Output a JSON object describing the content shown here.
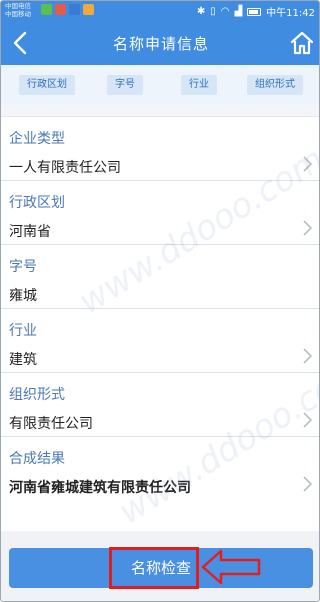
{
  "status_bar": {
    "carrier_line1": "中国电信",
    "carrier_line2": "中国移动",
    "time": "中午11:42",
    "icon_colors": [
      "#5bbf4e",
      "#e65a4a",
      "#3a7ad6",
      "#f2a93b"
    ]
  },
  "nav": {
    "title": "名称申请信息",
    "back_icon": "chevron-left-icon",
    "home_icon": "home-icon"
  },
  "chips": [
    "行政区划",
    "字号",
    "行业",
    "组织形式"
  ],
  "form": {
    "rows": [
      {
        "label": "企业类型",
        "value": "一人有限责任公司",
        "has_chevron": true
      },
      {
        "label": "行政区划",
        "value": "河南省",
        "has_chevron": true
      },
      {
        "label": "字号",
        "value": "雍城",
        "has_chevron": false
      },
      {
        "label": "行业",
        "value": "建筑",
        "has_chevron": true
      },
      {
        "label": "组织形式",
        "value": "有限责任公司",
        "has_chevron": true
      },
      {
        "label": "合成结果",
        "value": "河南省雍城建筑有限责任公司",
        "has_chevron": true
      }
    ]
  },
  "actions": {
    "check_label": "名称检查"
  },
  "watermark": "www.ddooo.com",
  "colors": {
    "primary": "#3f8ce0",
    "button": "#4a90e2",
    "label": "#4a78b8",
    "highlight": "#e02020"
  }
}
